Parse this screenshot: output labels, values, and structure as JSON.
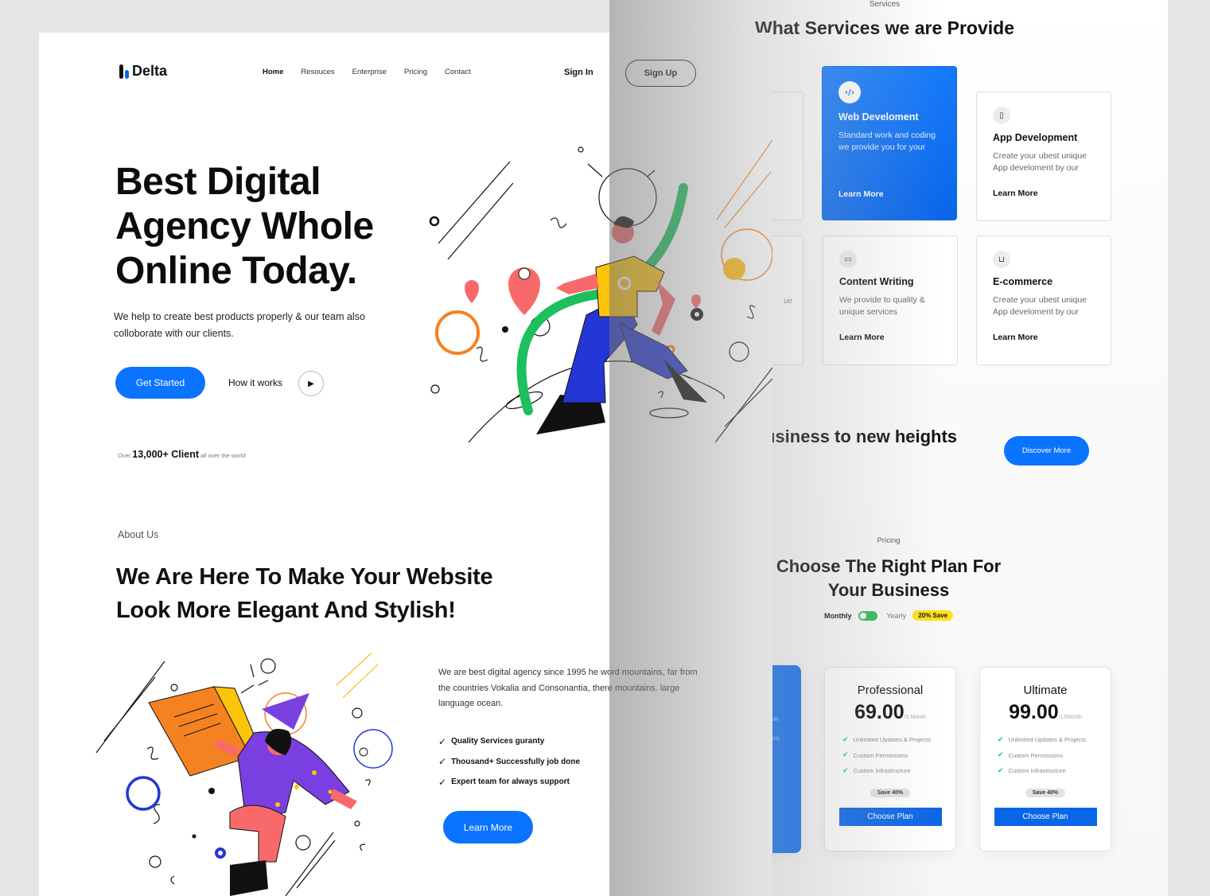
{
  "services": {
    "eyebrow": "Services",
    "title": "What Services we are Provide",
    "cards": [
      {
        "name": "Web Develoment",
        "desc": "Standard work and coding we provide you for your",
        "link": "Learn More",
        "icon": "code-icon",
        "glyph": "‹/›"
      },
      {
        "name": "App Development",
        "desc": "Create your ubest unique App develoment by our",
        "link": "Learn More",
        "icon": "mobile-icon",
        "glyph": "▯"
      },
      {
        "name": "Content Writing",
        "desc": "We provide to quality & unique services",
        "link": "Learn More",
        "icon": "video-icon",
        "glyph": "▭"
      },
      {
        "name": "E-commerce",
        "desc": "Create your ubest unique App develoment by our",
        "link": "Learn More",
        "icon": "cart-icon",
        "glyph": "⊔"
      }
    ],
    "partial_text": "ue"
  },
  "banner": {
    "text": "usiness to new heights",
    "button": "Discover More"
  },
  "pricing": {
    "eyebrow": "Pricing",
    "title_line1": "Choose The Right Plan For",
    "title_line2": "Your Business",
    "toggle": {
      "monthly": "Monthly",
      "yearly": "Yearly",
      "save": "20% Save",
      "monthly_on": true
    },
    "plans": [
      {
        "name": "Professional",
        "price": "69.00",
        "period": "/3 Month",
        "features": [
          "Unlimited Updates & Projects",
          "Custom Permissions",
          "Custom Infrastructure"
        ],
        "save": "Save 40%",
        "button": "Choose Plan"
      },
      {
        "name": "Ultimate",
        "price": "99.00",
        "period": "/12Month",
        "features": [
          "Unlimited Updates & Projects",
          "Custom Permissions",
          "Custom Infrastructure"
        ],
        "save": "Save 40%",
        "button": "Choose Plan"
      }
    ],
    "partial_blue": {
      "line1": "onth",
      "line2": "ects"
    }
  },
  "header": {
    "logo": "Delta",
    "nav": [
      "Home",
      "Resouces",
      "Enterprise",
      "Pricing",
      "Contact"
    ],
    "sign_in": "Sign In",
    "sign_up": "Sign Up"
  },
  "hero": {
    "title_line1": "Best Digital",
    "title_line2": "Agency Whole",
    "title_line3": "Online Today.",
    "subtitle": "We help to create best products  properly & our team also colloborate with our clients.",
    "cta": "Get Started",
    "how": "How it works",
    "clients_pre": "Over",
    "clients_count": "13,000+ Client",
    "clients_post": "all over the world"
  },
  "about": {
    "eyebrow": "About Us",
    "title_line1": "We Are Here To Make Your Website",
    "title_line2": "Look More Elegant And Stylish!",
    "text": "We are best digital agency since 1995 he word mountains, far from the countries Vokalia and Consonantia, there mountains. large language ocean.",
    "points": [
      "Quality Services guranty",
      "Thousand+ Successfully job done",
      "Expert team for always support"
    ],
    "cta": "Learn More"
  },
  "colors": {
    "accent": "#0a73ff",
    "green": "#2fbd55",
    "yellow": "#ffe11a"
  }
}
